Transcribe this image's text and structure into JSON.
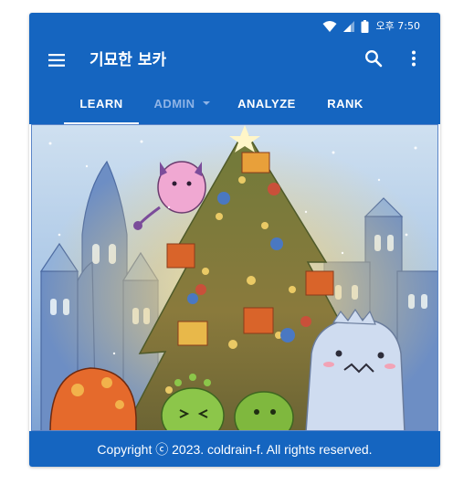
{
  "status_bar": {
    "icons": [
      "wifi-icon",
      "signal-icon",
      "battery-icon"
    ],
    "time": "오후 7:50"
  },
  "app_bar": {
    "title": "기묘한 보카",
    "icons": [
      "menu-icon",
      "search-icon",
      "more-vert-icon"
    ]
  },
  "tabs": [
    {
      "label": "LEARN",
      "active": true
    },
    {
      "label": "ADMIN",
      "active": false,
      "has_dropdown": true
    },
    {
      "label": "ANALYZE",
      "active": false
    },
    {
      "label": "RANK",
      "active": false
    }
  ],
  "footer": {
    "copyright": "Copyright ⓒ 2023. coldrain-f. All rights reserved."
  },
  "colors": {
    "primary": "#1565c0",
    "inactive_tab": "#8fb4e6",
    "on_primary": "#ffffff"
  }
}
